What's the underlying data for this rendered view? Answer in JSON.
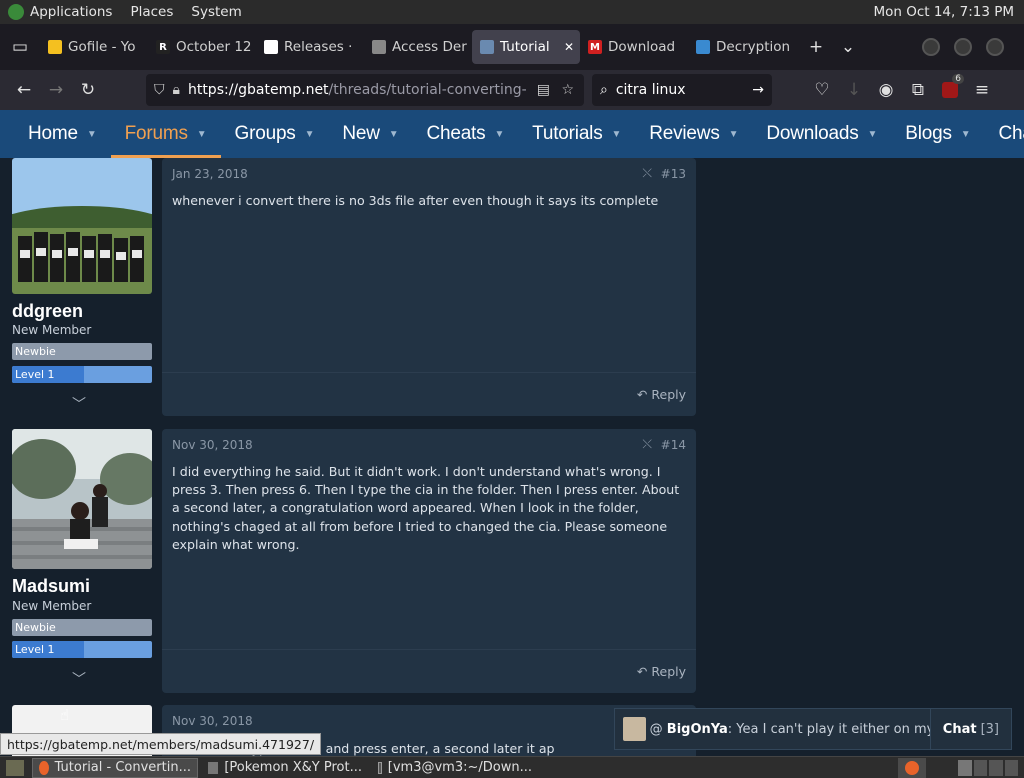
{
  "gnome": {
    "menus": [
      "Applications",
      "Places",
      "System"
    ],
    "clock": "Mon Oct 14,  7:13 PM"
  },
  "tabs": [
    {
      "label": "Gofile - Yo",
      "fav_color": "#f4c020",
      "fav_text": ""
    },
    {
      "label": "October 12",
      "fav_color": "#222222",
      "fav_text": "R"
    },
    {
      "label": "Releases · ",
      "fav_color": "#ffffff",
      "fav_text": ""
    },
    {
      "label": "Access Der",
      "fav_color": "#888888",
      "fav_text": ""
    },
    {
      "label": "Tutorial",
      "fav_color": "#6a8ab0",
      "fav_text": "",
      "active": true
    },
    {
      "label": "Download",
      "fav_color": "#d02020",
      "fav_text": "M"
    },
    {
      "label": "Decryption",
      "fav_color": "#3a8ad0",
      "fav_text": ""
    }
  ],
  "url": {
    "host": "https://gbatemp.net",
    "path": "/threads/tutorial-converting-"
  },
  "search": {
    "value": "citra linux"
  },
  "extension_badge": "6",
  "nav": [
    {
      "label": "Home"
    },
    {
      "label": "Forums",
      "active": true
    },
    {
      "label": "Groups"
    },
    {
      "label": "New"
    },
    {
      "label": "Cheats"
    },
    {
      "label": "Tutorials"
    },
    {
      "label": "Reviews"
    },
    {
      "label": "Downloads"
    },
    {
      "label": "Blogs"
    },
    {
      "label": "Chat"
    }
  ],
  "posts": [
    {
      "user": "ddgreen",
      "title": "New Member",
      "rank": "Newbie",
      "level": "Level 1",
      "level_fill": 0.5,
      "date": "Jan 23, 2018",
      "num": "#13",
      "body": "whenever i convert there is no 3ds file after even though it says its complete",
      "reply": "Reply"
    },
    {
      "user": "Madsumi",
      "title": "New Member",
      "rank": "Newbie",
      "level": "Level 1",
      "level_fill": 0.5,
      "date": "Nov 30, 2018",
      "num": "#14",
      "body": "I did everything he said. But it didn't work. I don't understand what's wrong. I press 3. Then press 6. Then I type the cia in the folder. Then I press enter. About a second later, a congratulation word appeared. When I look in the folder, nothing's chaged at all from before I tried to changed the cia. Please someone explain what wrong.",
      "reply": "Reply"
    },
    {
      "date": "Nov 30, 2018",
      "body_partial": "er I type the cia and press enter, a second later it ap"
    }
  ],
  "chat": {
    "user": "BigOnYa",
    "message": ": Yea I can't play it either on my t...",
    "label": "Chat",
    "count": "[3]"
  },
  "status_url": "https://gbatemp.net/members/madsumi.471927/",
  "taskbar": [
    "Tutorial - Convertin...",
    "[Pokemon X&Y Prot...",
    "[vm3@vm3:~/Down..."
  ]
}
